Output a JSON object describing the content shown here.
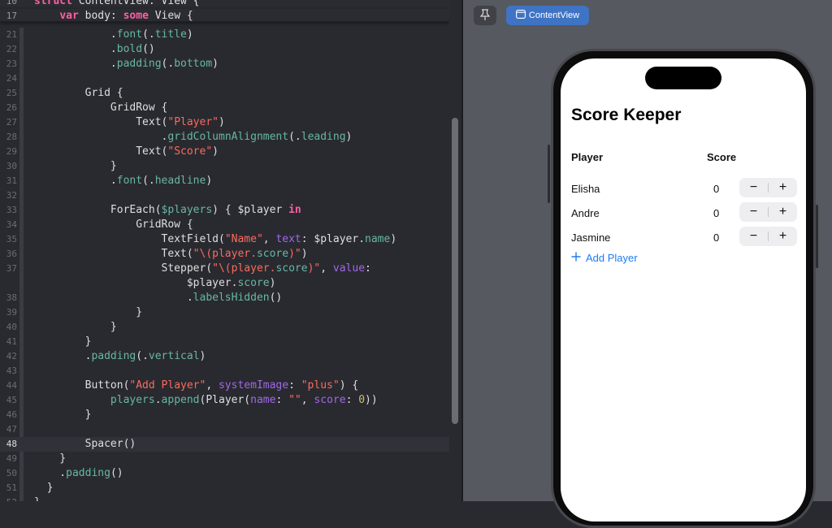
{
  "editor": {
    "sticky": [
      {
        "ln": "10",
        "html": "<span class=\"kw\">struct</span> ContentView: View {"
      },
      {
        "ln": "17",
        "html": "    <span class=\"kw\">var</span> body: <span class=\"kw\">some</span> View {"
      }
    ],
    "lines": [
      {
        "ln": "21",
        "html": "            .<span class=\"fn\">font</span>(.<span class=\"fn\">title</span>)"
      },
      {
        "ln": "22",
        "html": "            .<span class=\"fn\">bold</span>()"
      },
      {
        "ln": "23",
        "html": "            .<span class=\"fn\">padding</span>(.<span class=\"fn\">bottom</span>)"
      },
      {
        "ln": "24",
        "html": ""
      },
      {
        "ln": "25",
        "html": "        Grid {"
      },
      {
        "ln": "26",
        "html": "            GridRow {"
      },
      {
        "ln": "27",
        "html": "                Text(<span class=\"str\">\"Player\"</span>)"
      },
      {
        "ln": "28",
        "html": "                    .<span class=\"fn\">gridColumnAlignment</span>(.<span class=\"fn\">leading</span>)"
      },
      {
        "ln": "29",
        "html": "                Text(<span class=\"str\">\"Score\"</span>)"
      },
      {
        "ln": "30",
        "html": "            }"
      },
      {
        "ln": "31",
        "html": "            .<span class=\"fn\">font</span>(.<span class=\"fn\">headline</span>)"
      },
      {
        "ln": "32",
        "html": ""
      },
      {
        "ln": "33",
        "html": "            ForEach(<span class=\"fn\">$players</span>) { $player <span class=\"kw\">in</span>"
      },
      {
        "ln": "34",
        "html": "                GridRow {"
      },
      {
        "ln": "35",
        "html": "                    TextField(<span class=\"str\">\"Name\"</span>, <span class=\"prop\">text</span>: $player.<span class=\"fn\">name</span>)"
      },
      {
        "ln": "36",
        "html": "                    Text(<span class=\"str\">\"\\(player.<span class=\"fn\">score</span>)\"</span>)"
      },
      {
        "ln": "37",
        "html": "                    Stepper(<span class=\"str\">\"\\(player.<span class=\"fn\">score</span>)\"</span>, <span class=\"prop\">value</span>:"
      },
      {
        "ln": "",
        "html": "                        $player.<span class=\"fn\">score</span>)"
      },
      {
        "ln": "38",
        "html": "                        .<span class=\"fn\">labelsHidden</span>()"
      },
      {
        "ln": "39",
        "html": "                }"
      },
      {
        "ln": "40",
        "html": "            }"
      },
      {
        "ln": "41",
        "html": "        }"
      },
      {
        "ln": "42",
        "html": "        .<span class=\"fn\">padding</span>(.<span class=\"fn\">vertical</span>)"
      },
      {
        "ln": "43",
        "html": ""
      },
      {
        "ln": "44",
        "html": "        Button(<span class=\"str\">\"Add Player\"</span>, <span class=\"prop\">systemImage</span>: <span class=\"str\">\"plus\"</span>) {"
      },
      {
        "ln": "45",
        "html": "            <span class=\"fn\">players</span>.<span class=\"fn\">append</span>(Player(<span class=\"prop\">name</span>: <span class=\"str\">\"\"</span>, <span class=\"prop\">score</span>: <span class=\"num\">0</span>))"
      },
      {
        "ln": "46",
        "html": "        }"
      },
      {
        "ln": "47",
        "html": ""
      },
      {
        "ln": "48",
        "html": "        Spacer()",
        "current": true
      },
      {
        "ln": "49",
        "html": "    }"
      },
      {
        "ln": "50",
        "html": "    .<span class=\"fn\">padding</span>()"
      },
      {
        "ln": "51",
        "html": "  }"
      },
      {
        "ln": "52",
        "html": "}"
      }
    ]
  },
  "canvas": {
    "pin_icon": "pin-icon",
    "preview_tab_icon": "preview-window-icon",
    "preview_tab_label": "ContentView"
  },
  "app": {
    "title": "Score Keeper",
    "headers": {
      "player": "Player",
      "score": "Score"
    },
    "players": [
      {
        "name": "Elisha",
        "score": "0",
        "minus": "−",
        "plus": "+"
      },
      {
        "name": "Andre",
        "score": "0",
        "minus": "−",
        "plus": "+"
      },
      {
        "name": "Jasmine",
        "score": "0",
        "minus": "−",
        "plus": "+"
      }
    ],
    "add_button_icon": "plus-icon",
    "add_button_label": "Add Player"
  },
  "colors": {
    "editor_bg": "#292a30",
    "canvas_bg": "#56595f",
    "accent_blue": "#1e7cf2",
    "keyword": "#fc5fa3",
    "string": "#fc6a5d"
  }
}
